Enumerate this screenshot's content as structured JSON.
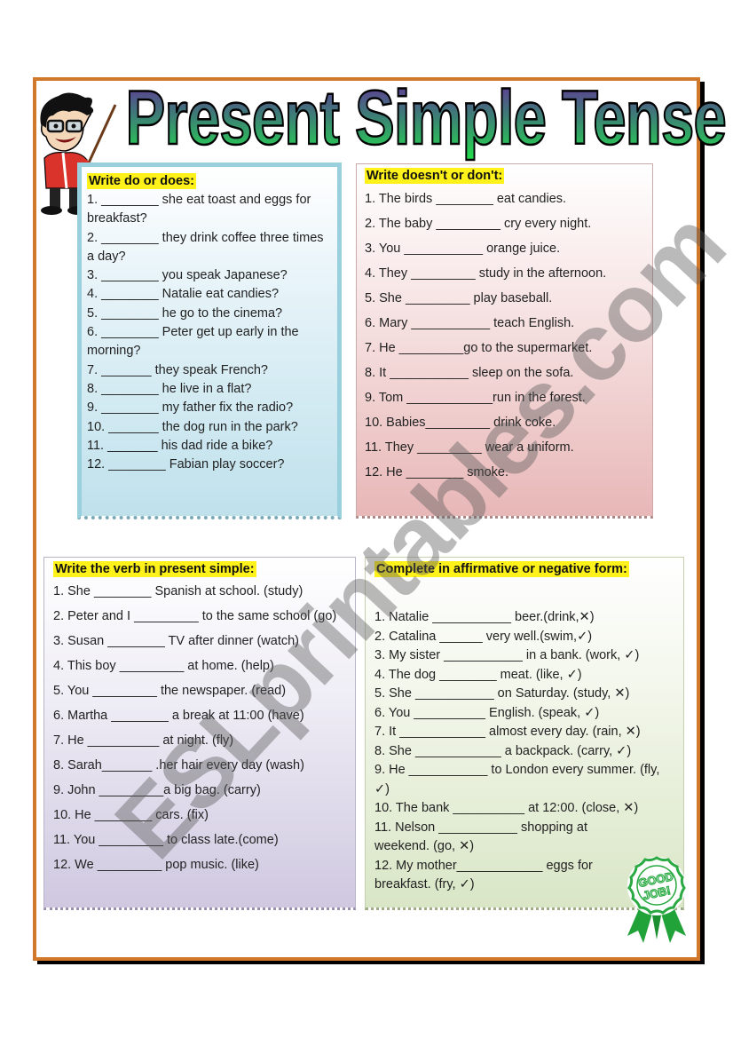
{
  "title": "Present Simple Tense",
  "watermark": "ESLprintables.com",
  "badge_text": "GOOD JOB!",
  "colors": {
    "frame": "#D2782A",
    "highlight": "#FFF21A",
    "title_gradient_top": "#6A2A9E",
    "title_gradient_bottom": "#22E04A"
  },
  "exercises": [
    {
      "heading": "Write do or does:",
      "items": [
        "1. ________ she eat toast and eggs for breakfast?",
        "2. ________ they drink coffee three times a day?",
        "3. ________ you speak Japanese?",
        "4. ________ Natalie eat candies?",
        "5. ________ he go to the cinema?",
        "6. ________  Peter get up early in the morning?",
        "7. _______ they speak French?",
        "8. ________ he live in a flat?",
        "9. ________ my father fix the radio?",
        "10. _______ the dog run in the park?",
        "11. _______ his dad ride a bike?",
        "12. ________ Fabian play soccer?"
      ]
    },
    {
      "heading": "Write doesn't or don't:",
      "items": [
        "1. The birds ________ eat candies.",
        "2. The baby _________ cry every night.",
        "3. You ___________ orange juice.",
        "4.  They _________ study in the afternoon.",
        "5.  She _________ play baseball.",
        "6. Mary ___________ teach English.",
        "7. He _________go to the supermarket.",
        "8. It ___________ sleep on the sofa.",
        "9. Tom ____________run in the forest.",
        "10. Babies_________ drink coke.",
        "11. They _________ wear a uniform.",
        "12. He ________ smoke."
      ]
    },
    {
      "heading": "Write the verb in present simple:",
      "items": [
        "1. She ________ Spanish at school. (study)",
        "2. Peter and I _________ to the same school (go)",
        "3. Susan ________ TV after dinner (watch)",
        "4. This boy _________ at home. (help)",
        "5. You _________ the newspaper. (read)",
        "6. Martha ________ a break at 11:00 (have)",
        "7. He __________ at night. (fly)",
        "8. Sarah_______ .her hair every day (wash)",
        "9. John _________a big bag. (carry)",
        "10. He ________ cars. (fix)",
        "11. You _________ to class late.(come)",
        "12. We  _________ pop music. (like)"
      ]
    },
    {
      "heading": "Complete in affirmative or negative form:",
      "items": [
        "1. Natalie ___________  beer.(drink,✕)",
        "2. Catalina ______ very well.(swim,✓)",
        "3. My sister ___________ in a bank. (work, ✓)",
        "4. The dog ________ meat. (like, ✓)",
        "5. She ___________ on Saturday. (study, ✕)",
        "6. You __________ English. (speak, ✓)",
        "7. It ____________ almost every day. (rain, ✕)",
        "8. She ____________ a backpack. (carry, ✓)",
        "9. He ___________ to London every summer. (fly, ✓)",
        "10. The bank __________ at 12:00. (close, ✕)",
        "11. Nelson ___________ shopping at weekend. (go, ✕)",
        "12. My mother____________ eggs for breakfast. (fry, ✓)"
      ]
    }
  ]
}
